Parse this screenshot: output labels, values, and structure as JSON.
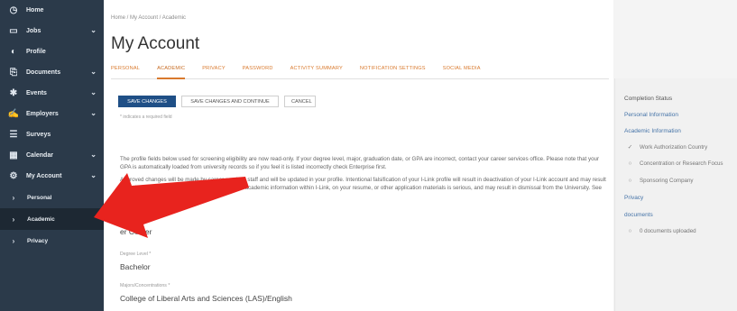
{
  "sidebar": {
    "items": [
      {
        "label": "Home",
        "icon": "clock-icon",
        "glyph": "◷",
        "chevron": false
      },
      {
        "label": "Jobs",
        "icon": "briefcase-icon",
        "glyph": "▭",
        "chevron": true
      },
      {
        "label": "Profile",
        "icon": "profile-icon",
        "glyph": "◐",
        "chevron": false
      },
      {
        "label": "Documents",
        "icon": "document-icon",
        "glyph": "⎘",
        "chevron": true
      },
      {
        "label": "Events",
        "icon": "events-icon",
        "glyph": "✱",
        "chevron": true
      },
      {
        "label": "Employers",
        "icon": "employers-icon",
        "glyph": "✍",
        "chevron": true
      },
      {
        "label": "Surveys",
        "icon": "list-icon",
        "glyph": "☰",
        "chevron": false
      },
      {
        "label": "Calendar",
        "icon": "calendar-icon",
        "glyph": "▦",
        "chevron": true
      },
      {
        "label": "My Account",
        "icon": "gear-icon",
        "glyph": "⚙",
        "chevron": true
      }
    ],
    "sub_items": [
      {
        "label": "Personal",
        "glyph": "›"
      },
      {
        "label": "Academic",
        "glyph": "›"
      },
      {
        "label": "Privacy",
        "glyph": "›"
      }
    ],
    "chevron_glyph": "⌄"
  },
  "main": {
    "breadcrumb": "Home / My Account / Academic",
    "title": "My Account",
    "tabs": [
      "PERSONAL",
      "ACADEMIC",
      "PRIVACY",
      "PASSWORD",
      "ACTIVITY SUMMARY",
      "NOTIFICATION SETTINGS",
      "SOCIAL MEDIA"
    ],
    "buttons": {
      "save": "SAVE CHANGES",
      "save_continue": "SAVE CHANGES AND CONTINUE",
      "cancel": "CANCEL"
    },
    "required_note": "* indicates a required field",
    "paragraph1": "The profile fields below used for screening eligibility are now read-only. If your degree level, major, graduation date, or GPA are incorrect, contact your career services office. Please note that your GPA is automatically loaded from university records so if you feel it is listed incorrectly check Enterprise first.",
    "paragraph2_before": "Approved changes will be made by career services staff and will be updated in your profile. Intentional falsification of your I-Link profile will result in deactivation of your I-Link account and may result in student disciplinary action. Misrepresentation of academic information within I-Link, on your resume, or other application materials is serious, and may result in dismissal from the University. See the full ",
    "paragraph2_link": "I-Link agreement",
    "paragraph2_after": ".",
    "fields": [
      {
        "label": "",
        "value": "er Center"
      },
      {
        "label": "Degree Level *",
        "value": "Bachelor"
      },
      {
        "label": "Majors/Concentrations *",
        "value": "College of Liberal Arts and Sciences (LAS)/English"
      }
    ]
  },
  "panel": {
    "title": "Completion Status",
    "links": [
      "Personal Information",
      "Academic Information"
    ],
    "academic_items": [
      {
        "label": "Work Authorization Country",
        "glyph": "✓",
        "icon": "check-icon"
      },
      {
        "label": "Concentration or Research Focus",
        "glyph": "○",
        "icon": "circle-icon"
      },
      {
        "label": "Sponsoring Company",
        "glyph": "○",
        "icon": "circle-icon"
      }
    ],
    "privacy": "Privacy",
    "documents": "documents",
    "documents_item": {
      "label": "0 documents uploaded",
      "glyph": "○"
    }
  },
  "colors": {
    "sidebar_bg": "#2b3a4a",
    "sidebar_active": "#1d2833",
    "tab_accent": "#d9792d",
    "primary_button": "#1f4f86",
    "arrow": "#e8231e"
  }
}
